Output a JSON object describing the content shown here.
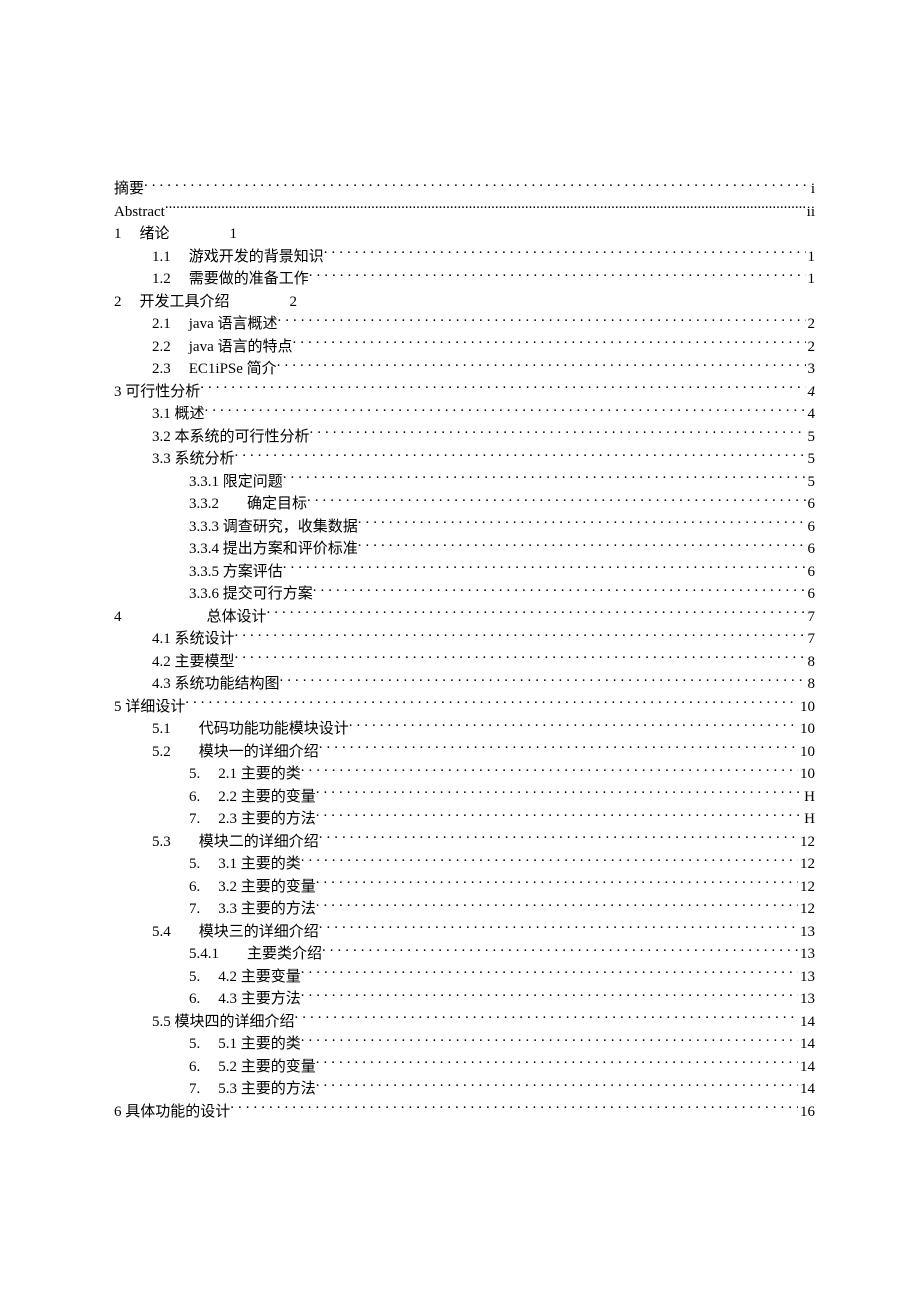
{
  "toc": [
    {
      "indent": 0,
      "label": "摘要",
      "page": "i",
      "leader": true
    },
    {
      "indent": 0,
      "label": "Abstract",
      "page": "ii",
      "leader": true,
      "tight": true,
      "roman": true
    },
    {
      "indent": 0,
      "num": "1",
      "label": "绪论",
      "extra": "1",
      "leader": false
    },
    {
      "indent": 1,
      "num": "1.1",
      "label": "游戏开发的背景知识",
      "page": "1",
      "leader": true
    },
    {
      "indent": 1,
      "num": "1.2",
      "label": "需要做的准备工作",
      "page": "1",
      "leader": true
    },
    {
      "indent": 0,
      "num": "2",
      "label": "开发工具介绍",
      "extra": "2",
      "leader": false
    },
    {
      "indent": 1,
      "num": "2.1",
      "label": "java 语言概述",
      "page": "2",
      "leader": true
    },
    {
      "indent": 1,
      "num": "2.2",
      "label": "java 语言的特点",
      "page": "2",
      "leader": true
    },
    {
      "indent": 1,
      "num": "2.3",
      "label": "EC1iPSe 简介",
      "page": "3",
      "leader": true
    },
    {
      "indent": 0,
      "label": "3 可行性分析",
      "page": "4",
      "leader": true,
      "italicPage": true
    },
    {
      "indent": 1,
      "label": "3.1 概述",
      "page": "4",
      "leader": true
    },
    {
      "indent": 1,
      "label": "3.2 本系统的可行性分析",
      "page": "5",
      "leader": true
    },
    {
      "indent": 1,
      "label": "3.3 系统分析",
      "page": "5",
      "leader": true
    },
    {
      "indent": 2,
      "label": "3.3.1 限定问题",
      "page": "5",
      "leader": true
    },
    {
      "indent": 2,
      "num": "3.3.2",
      "label": "确定目标",
      "page": "6",
      "leader": true,
      "gap": "md"
    },
    {
      "indent": 2,
      "label": "3.3.3 调查研究，收集数据",
      "page": "6",
      "leader": true
    },
    {
      "indent": 2,
      "label": "3.3.4 提出方案和评价标准",
      "page": "6",
      "leader": true
    },
    {
      "indent": 2,
      "label": "3.3.5 方案评估",
      "page": "6",
      "leader": true
    },
    {
      "indent": 2,
      "label": "3.3.6 提交可行方案",
      "page": "6",
      "leader": true
    },
    {
      "indent": 0,
      "num": "4",
      "label": "总体设计",
      "page": "7",
      "leader": true,
      "gap": "lg",
      "padnum": true
    },
    {
      "indent": 1,
      "label": "4.1 系统设计",
      "page": "7",
      "leader": true
    },
    {
      "indent": 1,
      "label": "4.2 主要模型",
      "page": "8",
      "leader": true
    },
    {
      "indent": 1,
      "label": "4.3 系统功能结构图",
      "page": "8",
      "leader": true
    },
    {
      "indent": 0,
      "label": "5 详细设计",
      "page": "10",
      "leader": true
    },
    {
      "indent": 1,
      "num": "5.1",
      "label": "代码功能功能模块设计",
      "page": "10",
      "leader": true,
      "gap": "md"
    },
    {
      "indent": 1,
      "num": "5.2",
      "label": "模块一的详细介绍",
      "page": "10",
      "leader": true,
      "gap": "md"
    },
    {
      "indent": 2,
      "num": "5.",
      "label": "2.1 主要的类",
      "page": "10",
      "leader": true
    },
    {
      "indent": 2,
      "num": "6.",
      "label": "2.2 主要的变量",
      "page": "H",
      "leader": true
    },
    {
      "indent": 2,
      "num": "7.",
      "label": "2.3 主要的方法",
      "page": "H",
      "leader": true
    },
    {
      "indent": 1,
      "num": "5.3",
      "label": "模块二的详细介绍",
      "page": "12",
      "leader": true,
      "gap": "md"
    },
    {
      "indent": 2,
      "num": "5.",
      "label": "3.1 主要的类",
      "page": "12",
      "leader": true
    },
    {
      "indent": 2,
      "num": "6.",
      "label": "3.2 主要的变量",
      "page": "12",
      "leader": true
    },
    {
      "indent": 2,
      "num": "7.",
      "label": "3.3 主要的方法",
      "page": "12",
      "leader": true
    },
    {
      "indent": 1,
      "num": "5.4",
      "label": "模块三的详细介绍",
      "page": "13",
      "leader": true,
      "gap": "md"
    },
    {
      "indent": 2,
      "num": "5.4.1",
      "label": "主要类介绍",
      "page": "13",
      "leader": true,
      "gap": "md"
    },
    {
      "indent": 2,
      "num": "5.",
      "label": "4.2  主要变量",
      "page": "13",
      "leader": true
    },
    {
      "indent": 2,
      "num": "6.",
      "label": "4.3  主要方法",
      "page": "13",
      "leader": true
    },
    {
      "indent": 1,
      "label": "5.5 模块四的详细介绍",
      "page": "14",
      "leader": true
    },
    {
      "indent": 2,
      "num": "5.",
      "label": "5.1 主要的类",
      "page": "14",
      "leader": true
    },
    {
      "indent": 2,
      "num": "6.",
      "label": "5.2 主要的变量",
      "page": "14",
      "leader": true
    },
    {
      "indent": 2,
      "num": "7.",
      "label": "5.3 主要的方法",
      "page": "14",
      "leader": true
    },
    {
      "indent": 0,
      "label": "6 具体功能的设计",
      "page": "16",
      "leader": true
    }
  ]
}
